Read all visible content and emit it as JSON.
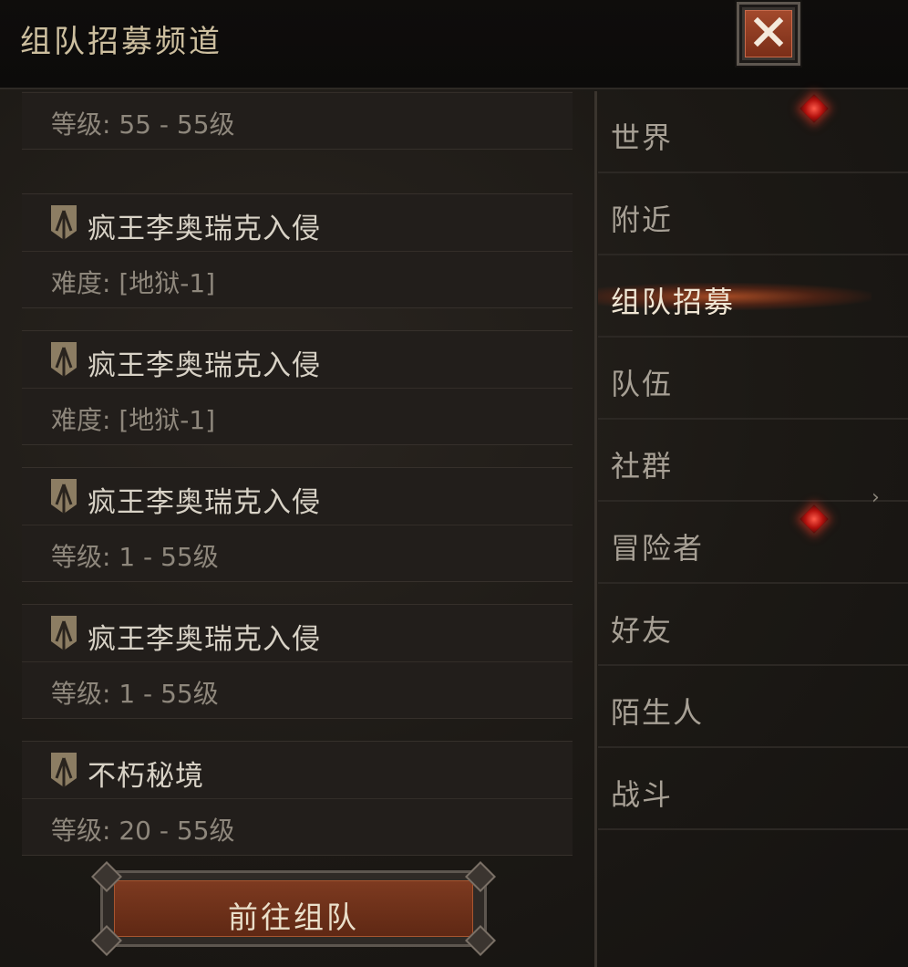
{
  "header": {
    "title": "组队招募频道"
  },
  "list": {
    "cards": [
      {
        "name": "",
        "label": "等级:",
        "value": "55 - 55级"
      },
      {
        "name": "疯王李奥瑞克入侵",
        "label": "难度:",
        "value": "[地狱-1]"
      },
      {
        "name": "疯王李奥瑞克入侵",
        "label": "难度:",
        "value": "[地狱-1]"
      },
      {
        "name": "疯王李奥瑞克入侵",
        "label": "等级:",
        "value": "1 - 55级"
      },
      {
        "name": "疯王李奥瑞克入侵",
        "label": "等级:",
        "value": "1 - 55级"
      },
      {
        "name": "不朽秘境",
        "label": "等级:",
        "value": "20 - 55级"
      }
    ]
  },
  "go_button": {
    "label": "前往组队"
  },
  "tabs": [
    {
      "label": "世界",
      "badge": true,
      "active": false
    },
    {
      "label": "附近",
      "badge": false,
      "active": false
    },
    {
      "label": "组队招募",
      "badge": false,
      "active": true
    },
    {
      "label": "队伍",
      "badge": false,
      "active": false
    },
    {
      "label": "社群",
      "badge": false,
      "active": false
    },
    {
      "label": "冒险者",
      "badge": true,
      "active": false
    },
    {
      "label": "好友",
      "badge": false,
      "active": false
    },
    {
      "label": "陌生人",
      "badge": false,
      "active": false
    },
    {
      "label": "战斗",
      "badge": false,
      "active": false
    }
  ],
  "chevron": "›",
  "colors": {
    "accent": "#a2492c",
    "badge": "#e0281c",
    "text_primary": "#d8d2c6",
    "text_muted": "#8e877c"
  }
}
